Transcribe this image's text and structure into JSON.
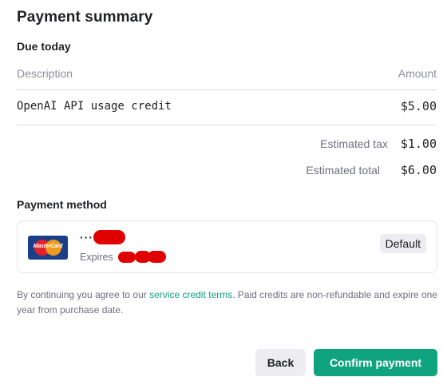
{
  "summary": {
    "title": "Payment summary",
    "due_today": "Due today",
    "columns": {
      "description": "Description",
      "amount": "Amount"
    },
    "line_items": [
      {
        "description": "OpenAI API usage credit",
        "amount": "$5.00"
      }
    ],
    "estimated_tax_label": "Estimated tax",
    "estimated_tax": "$1.00",
    "estimated_total_label": "Estimated total",
    "estimated_total": "$6.00"
  },
  "payment_method": {
    "title": "Payment method",
    "card_brand": "MasterCard",
    "card_icon": "mastercard-logo",
    "masked_number_prefix": "····",
    "expires_label": "Expires",
    "badge": "Default"
  },
  "terms": {
    "prefix": "By continuing you agree to our ",
    "link": "service credit terms",
    "suffix": ". Paid credits are non-refundable and expire one year from purchase date."
  },
  "actions": {
    "back": "Back",
    "confirm": "Confirm payment"
  },
  "colors": {
    "accent": "#10a37f",
    "muted": "#6e6e80",
    "redaction": "#e00000"
  }
}
